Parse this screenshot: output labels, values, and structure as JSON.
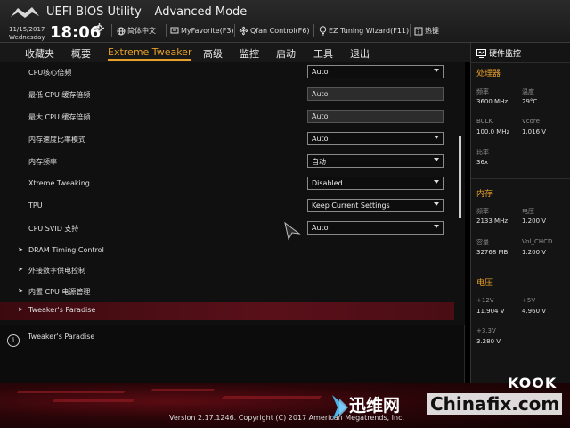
{
  "header": {
    "title": "UEFI BIOS Utility – Advanced Mode",
    "date": "11/15/2017",
    "weekday": "Wednesday",
    "time": "18:06",
    "toolbar": [
      {
        "label": "简体中文",
        "icon": "globe-icon"
      },
      {
        "label": "MyFavorite(F3)",
        "icon": "favorite-icon"
      },
      {
        "label": "Qfan Control(F6)",
        "icon": "fan-icon"
      },
      {
        "label": "EZ Tuning Wizard(F11)",
        "icon": "bulb-icon"
      },
      {
        "label": "热键",
        "icon": "hotkey-icon"
      }
    ]
  },
  "nav": {
    "tabs": [
      "收藏夹",
      "概要",
      "Extreme Tweaker",
      "高级",
      "监控",
      "启动",
      "工具",
      "退出"
    ],
    "active": "Extreme Tweaker"
  },
  "settings": [
    {
      "label": "CPU核心倍频",
      "value": "Auto",
      "kind": "select"
    },
    {
      "label": "最低 CPU 缓存倍频",
      "value": "Auto",
      "kind": "readonly"
    },
    {
      "label": "最大 CPU 缓存倍频",
      "value": "Auto",
      "kind": "readonly"
    },
    {
      "label": "内存速度比率模式",
      "value": "Auto",
      "kind": "select"
    },
    {
      "label": "内存频率",
      "value": "自动",
      "kind": "select"
    },
    {
      "label": "Xtreme Tweaking",
      "value": "Disabled",
      "kind": "select"
    },
    {
      "label": "TPU",
      "value": "Keep Current Settings",
      "kind": "select"
    },
    {
      "label": "CPU SVID 支持",
      "value": "Auto",
      "kind": "select"
    }
  ],
  "submenus": [
    {
      "label": "DRAM Timing Control"
    },
    {
      "label": "外接数字供电控制"
    },
    {
      "label": "内置 CPU 电源管理"
    },
    {
      "label": "Tweaker's Paradise",
      "selected": true
    }
  ],
  "help": {
    "text": "Tweaker's Paradise"
  },
  "hw_monitor": {
    "title": "硬件监控",
    "cpu": {
      "section": "处理器",
      "freq_label": "频率",
      "freq": "3600 MHz",
      "temp_label": "温度",
      "temp": "29°C",
      "bclk_label": "BCLK",
      "bclk": "100.0 MHz",
      "vcore_label": "Vcore",
      "vcore": "1.016 V",
      "ratio_label": "比率",
      "ratio": "36x"
    },
    "memory": {
      "section": "内存",
      "freq_label": "频率",
      "freq": "2133 MHz",
      "volt_label": "电压",
      "volt": "1.200 V",
      "cap_label": "容量",
      "cap": "32768 MB",
      "vol_chcd_label": "Vol_CHCD",
      "vol_chcd": "1.200 V"
    },
    "voltage": {
      "section": "电压",
      "v12_label": "+12V",
      "v12": "11.904 V",
      "v5_label": "+5V",
      "v5": "4.960 V",
      "v33_label": "+3.3V",
      "v33": "3.280 V"
    }
  },
  "footer": {
    "version": "Version 2.17.1246. Copyright (C) 2017 American Megatrends, Inc."
  },
  "watermark": {
    "cn": "迅维网",
    "en": "Chinafix.com",
    "corner": "KOOK"
  },
  "colors": {
    "accent": "#e7a02a",
    "highlight": "#5a1019"
  }
}
